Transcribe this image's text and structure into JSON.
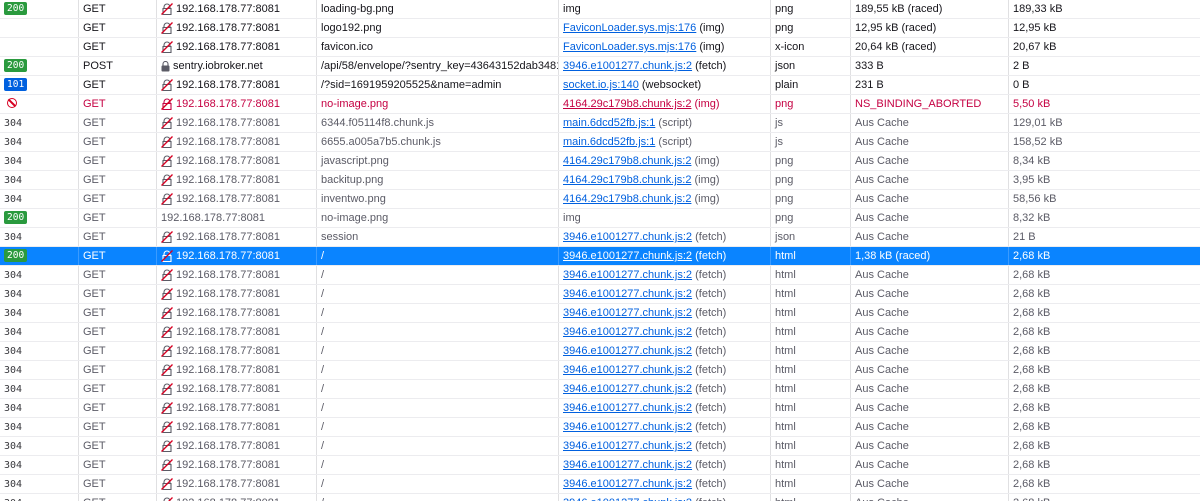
{
  "rows": [
    {
      "status": "200",
      "status_style": "badge-200",
      "method": "GET",
      "domain": "192.168.178.77:8081",
      "domain_icon": "lock-slash-icon",
      "file": "loading-bg.png",
      "initiator": "img",
      "initiator_link": "",
      "type": "png",
      "transferred": "189,55 kB (raced)",
      "size": "189,33 kB",
      "style": "normal"
    },
    {
      "status": "",
      "status_style": "",
      "method": "GET",
      "domain": "192.168.178.77:8081",
      "domain_icon": "lock-slash-icon",
      "file": "logo192.png",
      "initiator": " (img)",
      "initiator_link": "FaviconLoader.sys.mjs:176",
      "type": "png",
      "transferred": "12,95 kB (raced)",
      "size": "12,95 kB",
      "style": "normal"
    },
    {
      "status": "",
      "status_style": "",
      "method": "GET",
      "domain": "192.168.178.77:8081",
      "domain_icon": "lock-slash-icon",
      "file": "favicon.ico",
      "initiator": " (img)",
      "initiator_link": "FaviconLoader.sys.mjs:176",
      "type": "x-icon",
      "transferred": "20,64 kB (raced)",
      "size": "20,67 kB",
      "style": "normal"
    },
    {
      "status": "200",
      "status_style": "badge-200",
      "method": "POST",
      "domain": "sentry.iobroker.net",
      "domain_icon": "lock-icon",
      "file": "/api/58/envelope/?sentry_key=43643152dab3481db69950ba8",
      "initiator": " (fetch)",
      "initiator_link": "3946.e1001277.chunk.js:2",
      "type": "json",
      "transferred": "333 B",
      "size": "2 B",
      "style": "normal"
    },
    {
      "status": "101",
      "status_style": "badge-101",
      "method": "GET",
      "domain": "192.168.178.77:8081",
      "domain_icon": "lock-slash-icon",
      "file": "/?sid=1691959205525&name=admin",
      "initiator": " (websocket)",
      "initiator_link": "socket.io.js:140",
      "type": "plain",
      "transferred": "231 B",
      "size": "0 B",
      "style": "normal"
    },
    {
      "status": "",
      "status_style": "blocked",
      "method": "GET",
      "domain": "192.168.178.77:8081",
      "domain_icon": "lock-slash-icon",
      "file": "no-image.png",
      "initiator": " (img)",
      "initiator_link": "4164.29c179b8.chunk.js:2",
      "type": "png",
      "transferred": "NS_BINDING_ABORTED",
      "size": "5,50 kB",
      "style": "error"
    },
    {
      "status": "304",
      "status_style": "plain",
      "method": "GET",
      "domain": "192.168.178.77:8081",
      "domain_icon": "lock-slash-icon",
      "file": "6344.f05114f8.chunk.js",
      "initiator": " (script)",
      "initiator_link": "main.6dcd52fb.js:1",
      "type": "js",
      "transferred": "Aus Cache",
      "size": "129,01 kB",
      "style": "cached"
    },
    {
      "status": "304",
      "status_style": "plain",
      "method": "GET",
      "domain": "192.168.178.77:8081",
      "domain_icon": "lock-slash-icon",
      "file": "6655.a005a7b5.chunk.js",
      "initiator": " (script)",
      "initiator_link": "main.6dcd52fb.js:1",
      "type": "js",
      "transferred": "Aus Cache",
      "size": "158,52 kB",
      "style": "cached"
    },
    {
      "status": "304",
      "status_style": "plain",
      "method": "GET",
      "domain": "192.168.178.77:8081",
      "domain_icon": "lock-slash-icon",
      "file": "javascript.png",
      "initiator": " (img)",
      "initiator_link": "4164.29c179b8.chunk.js:2",
      "type": "png",
      "transferred": "Aus Cache",
      "size": "8,34 kB",
      "style": "cached"
    },
    {
      "status": "304",
      "status_style": "plain",
      "method": "GET",
      "domain": "192.168.178.77:8081",
      "domain_icon": "lock-slash-icon",
      "file": "backitup.png",
      "initiator": " (img)",
      "initiator_link": "4164.29c179b8.chunk.js:2",
      "type": "png",
      "transferred": "Aus Cache",
      "size": "3,95 kB",
      "style": "cached"
    },
    {
      "status": "304",
      "status_style": "plain",
      "method": "GET",
      "domain": "192.168.178.77:8081",
      "domain_icon": "lock-slash-icon",
      "file": "inventwo.png",
      "initiator": " (img)",
      "initiator_link": "4164.29c179b8.chunk.js:2",
      "type": "png",
      "transferred": "Aus Cache",
      "size": "58,56 kB",
      "style": "cached"
    },
    {
      "status": "200",
      "status_style": "badge-200",
      "method": "GET",
      "domain": "192.168.178.77:8081",
      "domain_icon": "",
      "file": "no-image.png",
      "initiator": "img",
      "initiator_link": "",
      "type": "png",
      "transferred": "Aus Cache",
      "size": "8,32 kB",
      "style": "cached"
    },
    {
      "status": "304",
      "status_style": "plain",
      "method": "GET",
      "domain": "192.168.178.77:8081",
      "domain_icon": "lock-slash-icon",
      "file": "session",
      "initiator": " (fetch)",
      "initiator_link": "3946.e1001277.chunk.js:2",
      "type": "json",
      "transferred": "Aus Cache",
      "size": "21 B",
      "style": "cached"
    },
    {
      "status": "200",
      "status_style": "badge-200",
      "method": "GET",
      "domain": "192.168.178.77:8081",
      "domain_icon": "lock-slash-icon",
      "file": "/",
      "initiator": " (fetch)",
      "initiator_link": "3946.e1001277.chunk.js:2",
      "type": "html",
      "transferred": "1,38 kB (raced)",
      "size": "2,68 kB",
      "style": "selected"
    },
    {
      "status": "304",
      "status_style": "plain",
      "method": "GET",
      "domain": "192.168.178.77:8081",
      "domain_icon": "lock-slash-icon",
      "file": "/",
      "initiator": " (fetch)",
      "initiator_link": "3946.e1001277.chunk.js:2",
      "type": "html",
      "transferred": "Aus Cache",
      "size": "2,68 kB",
      "style": "cached"
    },
    {
      "status": "304",
      "status_style": "plain",
      "method": "GET",
      "domain": "192.168.178.77:8081",
      "domain_icon": "lock-slash-icon",
      "file": "/",
      "initiator": " (fetch)",
      "initiator_link": "3946.e1001277.chunk.js:2",
      "type": "html",
      "transferred": "Aus Cache",
      "size": "2,68 kB",
      "style": "cached"
    },
    {
      "status": "304",
      "status_style": "plain",
      "method": "GET",
      "domain": "192.168.178.77:8081",
      "domain_icon": "lock-slash-icon",
      "file": "/",
      "initiator": " (fetch)",
      "initiator_link": "3946.e1001277.chunk.js:2",
      "type": "html",
      "transferred": "Aus Cache",
      "size": "2,68 kB",
      "style": "cached"
    },
    {
      "status": "304",
      "status_style": "plain",
      "method": "GET",
      "domain": "192.168.178.77:8081",
      "domain_icon": "lock-slash-icon",
      "file": "/",
      "initiator": " (fetch)",
      "initiator_link": "3946.e1001277.chunk.js:2",
      "type": "html",
      "transferred": "Aus Cache",
      "size": "2,68 kB",
      "style": "cached"
    },
    {
      "status": "304",
      "status_style": "plain",
      "method": "GET",
      "domain": "192.168.178.77:8081",
      "domain_icon": "lock-slash-icon",
      "file": "/",
      "initiator": " (fetch)",
      "initiator_link": "3946.e1001277.chunk.js:2",
      "type": "html",
      "transferred": "Aus Cache",
      "size": "2,68 kB",
      "style": "cached"
    },
    {
      "status": "304",
      "status_style": "plain",
      "method": "GET",
      "domain": "192.168.178.77:8081",
      "domain_icon": "lock-slash-icon",
      "file": "/",
      "initiator": " (fetch)",
      "initiator_link": "3946.e1001277.chunk.js:2",
      "type": "html",
      "transferred": "Aus Cache",
      "size": "2,68 kB",
      "style": "cached"
    },
    {
      "status": "304",
      "status_style": "plain",
      "method": "GET",
      "domain": "192.168.178.77:8081",
      "domain_icon": "lock-slash-icon",
      "file": "/",
      "initiator": " (fetch)",
      "initiator_link": "3946.e1001277.chunk.js:2",
      "type": "html",
      "transferred": "Aus Cache",
      "size": "2,68 kB",
      "style": "cached"
    },
    {
      "status": "304",
      "status_style": "plain",
      "method": "GET",
      "domain": "192.168.178.77:8081",
      "domain_icon": "lock-slash-icon",
      "file": "/",
      "initiator": " (fetch)",
      "initiator_link": "3946.e1001277.chunk.js:2",
      "type": "html",
      "transferred": "Aus Cache",
      "size": "2,68 kB",
      "style": "cached"
    },
    {
      "status": "304",
      "status_style": "plain",
      "method": "GET",
      "domain": "192.168.178.77:8081",
      "domain_icon": "lock-slash-icon",
      "file": "/",
      "initiator": " (fetch)",
      "initiator_link": "3946.e1001277.chunk.js:2",
      "type": "html",
      "transferred": "Aus Cache",
      "size": "2,68 kB",
      "style": "cached"
    },
    {
      "status": "304",
      "status_style": "plain",
      "method": "GET",
      "domain": "192.168.178.77:8081",
      "domain_icon": "lock-slash-icon",
      "file": "/",
      "initiator": " (fetch)",
      "initiator_link": "3946.e1001277.chunk.js:2",
      "type": "html",
      "transferred": "Aus Cache",
      "size": "2,68 kB",
      "style": "cached"
    },
    {
      "status": "304",
      "status_style": "plain",
      "method": "GET",
      "domain": "192.168.178.77:8081",
      "domain_icon": "lock-slash-icon",
      "file": "/",
      "initiator": " (fetch)",
      "initiator_link": "3946.e1001277.chunk.js:2",
      "type": "html",
      "transferred": "Aus Cache",
      "size": "2,68 kB",
      "style": "cached"
    },
    {
      "status": "304",
      "status_style": "plain",
      "method": "GET",
      "domain": "192.168.178.77:8081",
      "domain_icon": "lock-slash-icon",
      "file": "/",
      "initiator": " (fetch)",
      "initiator_link": "3946.e1001277.chunk.js:2",
      "type": "html",
      "transferred": "Aus Cache",
      "size": "2,68 kB",
      "style": "cached"
    },
    {
      "status": "304",
      "status_style": "plain",
      "method": "GET",
      "domain": "192.168.178.77:8081",
      "domain_icon": "lock-slash-icon",
      "file": "/",
      "initiator": " (fetch)",
      "initiator_link": "3946.e1001277.chunk.js:2",
      "type": "html",
      "transferred": "Aus Cache",
      "size": "2,68 kB",
      "style": "cached"
    }
  ]
}
